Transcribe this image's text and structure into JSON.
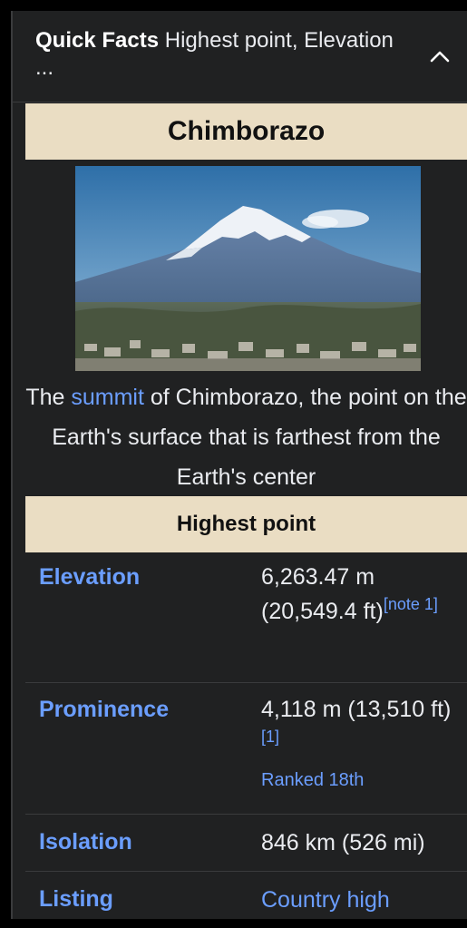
{
  "header": {
    "bold": "Quick Facts",
    "text": " Highest point, Elevation ..."
  },
  "title": "Chimborazo",
  "image": {
    "caption_pre": "The ",
    "caption_link": "summit",
    "caption_post": " of Chimborazo, the point on the Earth's surface that is farthest from the Earth's center"
  },
  "section": "Highest point",
  "rows": {
    "elevation": {
      "label": "Elevation",
      "value": "6,263.47 m (20,549.4 ft)",
      "ref": "[note 1]"
    },
    "prominence": {
      "label": "Prominence",
      "value": "4,118 m (13,510 ft)",
      "ref": "[1]",
      "extra": "Ranked 18th"
    },
    "isolation": {
      "label": "Isolation",
      "value": "846 km (526 mi)"
    },
    "listing": {
      "label": "Listing",
      "value": "Country high"
    }
  },
  "colors": {
    "accent": "#6b9eff",
    "band": "#eaddc3",
    "panel": "#202122"
  },
  "icons": {
    "collapse": "chevron-up-icon"
  }
}
